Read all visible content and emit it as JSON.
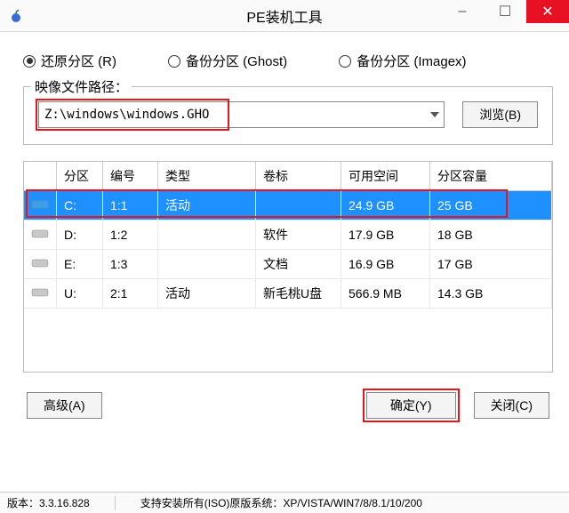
{
  "window": {
    "title": "PE装机工具"
  },
  "modes": {
    "restore": "还原分区 (R)",
    "backup_ghost": "备份分区 (Ghost)",
    "backup_imagex": "备份分区 (Imagex)",
    "selected": "restore"
  },
  "image": {
    "label": "映像文件路径：",
    "path": "Z:\\windows\\windows.GHO",
    "browse": "浏览(B)"
  },
  "table": {
    "headers": {
      "partition": "分区",
      "number": "编号",
      "type": "类型",
      "volume": "卷标",
      "free": "可用空间",
      "capacity": "分区容量"
    },
    "rows": [
      {
        "partition": "C:",
        "number": "1:1",
        "type": "活动",
        "volume": "",
        "free": "24.9 GB",
        "capacity": "25 GB",
        "selected": true,
        "iconColor": "#3aa0e8"
      },
      {
        "partition": "D:",
        "number": "1:2",
        "type": "",
        "volume": "软件",
        "free": "17.9 GB",
        "capacity": "18 GB",
        "selected": false,
        "iconColor": "#c8c8c8"
      },
      {
        "partition": "E:",
        "number": "1:3",
        "type": "",
        "volume": "文档",
        "free": "16.9 GB",
        "capacity": "17 GB",
        "selected": false,
        "iconColor": "#c8c8c8"
      },
      {
        "partition": "U:",
        "number": "2:1",
        "type": "活动",
        "volume": "新毛桃U盘",
        "free": "566.9 MB",
        "capacity": "14.3 GB",
        "selected": false,
        "iconColor": "#c8c8c8"
      }
    ]
  },
  "buttons": {
    "advanced": "高级(A)",
    "ok": "确定(Y)",
    "close": "关闭(C)"
  },
  "status": {
    "version": "版本：3.3.16.828",
    "support": "支持安装所有(ISO)原版系统：XP/VISTA/WIN7/8/8.1/10/200"
  }
}
